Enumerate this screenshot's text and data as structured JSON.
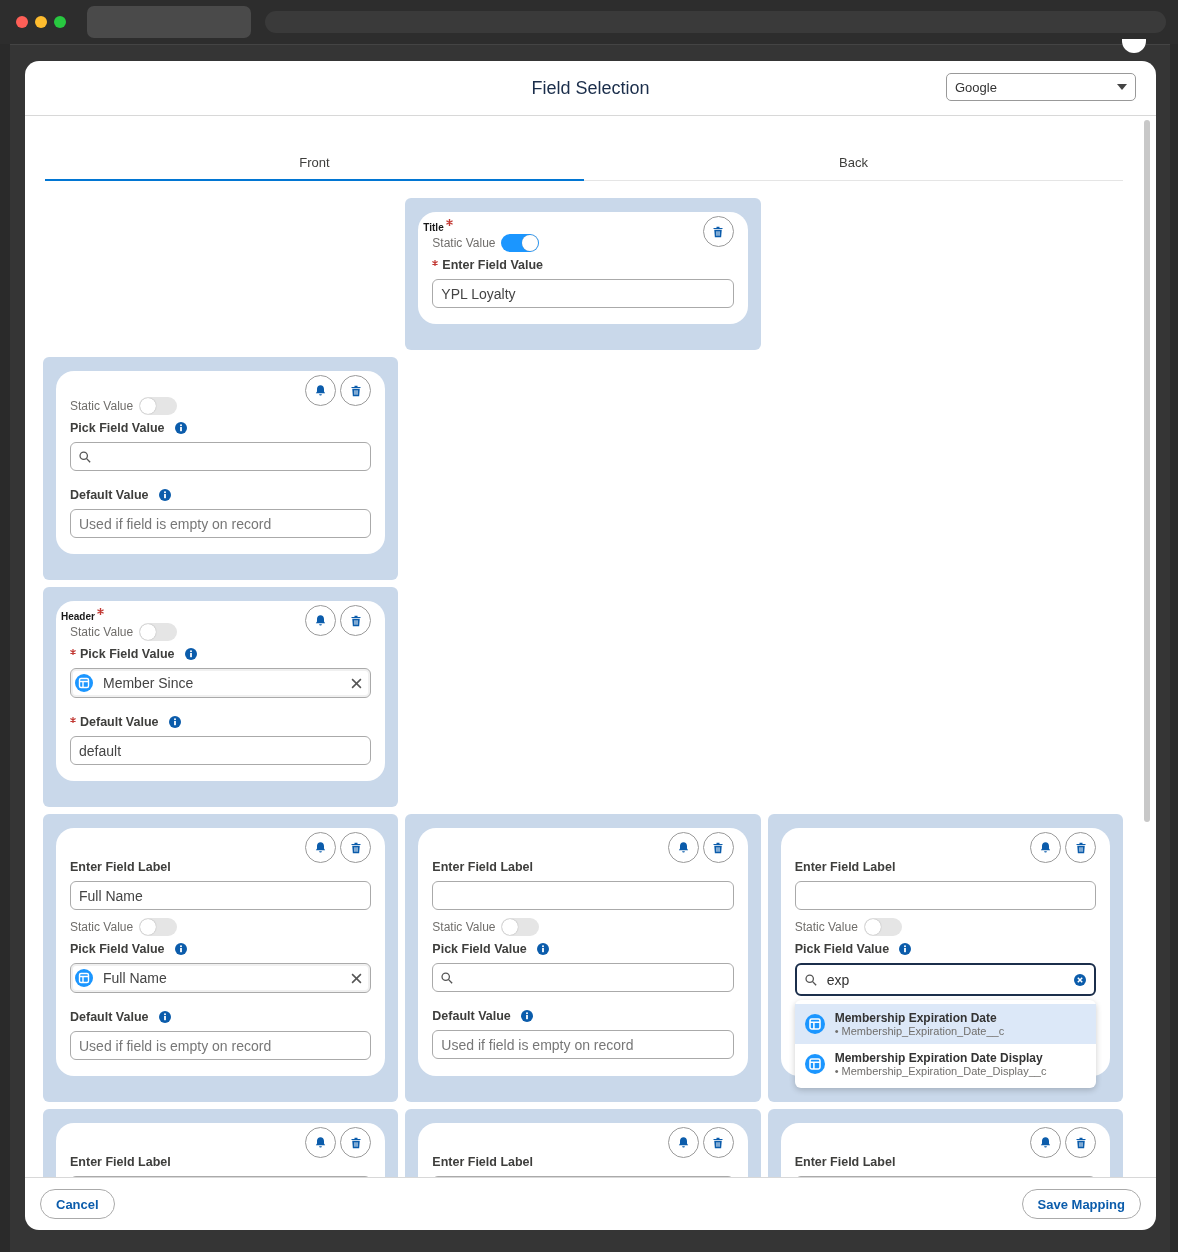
{
  "header": {
    "title": "Field Selection",
    "picker": {
      "value": "Google"
    }
  },
  "tabs": [
    {
      "label": "Front",
      "selected": true
    },
    {
      "label": "Back",
      "selected": false
    }
  ],
  "rows": [
    {
      "cells": [
        {
          "kind": "empty"
        },
        {
          "kind": "card",
          "section": "Title",
          "required": true,
          "bell": false,
          "parts": [
            {
              "kind": "toggle",
              "label": "Static Value",
              "on": true
            },
            {
              "kind": "label",
              "text": "Enter Field Value",
              "required": true,
              "info": false
            },
            {
              "kind": "text",
              "value": "YPL Loyalty"
            }
          ]
        },
        {
          "kind": "empty"
        }
      ]
    },
    {
      "cells": [
        {
          "kind": "card",
          "bell": true,
          "parts": [
            {
              "kind": "toggle",
              "label": "Static Value",
              "on": false
            },
            {
              "kind": "label",
              "text": "Pick Field Value",
              "required": false,
              "info": true
            },
            {
              "kind": "search",
              "focused": false
            },
            {
              "kind": "label",
              "text": "Default Value",
              "required": false,
              "info": true
            },
            {
              "kind": "text",
              "placeholder": "Used if field is empty on record"
            }
          ]
        },
        {
          "kind": "empty"
        },
        {
          "kind": "empty"
        }
      ]
    },
    {
      "cells": [
        {
          "kind": "card",
          "section": "Header",
          "required": true,
          "bell": true,
          "parts": [
            {
              "kind": "toggle",
              "label": "Static Value",
              "on": false
            },
            {
              "kind": "label",
              "text": "Pick Field Value",
              "required": true,
              "info": true
            },
            {
              "kind": "pill",
              "value": "Member Since"
            },
            {
              "kind": "label",
              "text": "Default Value",
              "required": true,
              "info": true
            },
            {
              "kind": "text",
              "value": "default"
            }
          ]
        },
        {
          "kind": "empty"
        },
        {
          "kind": "empty"
        }
      ]
    },
    {
      "cells": [
        {
          "kind": "card",
          "bell": true,
          "parts": [
            {
              "kind": "label",
              "text": "Enter Field Label",
              "required": false,
              "info": false
            },
            {
              "kind": "text",
              "value": "Full Name"
            },
            {
              "kind": "toggle",
              "label": "Static Value",
              "on": false
            },
            {
              "kind": "label",
              "text": "Pick Field Value",
              "required": false,
              "info": true
            },
            {
              "kind": "pill",
              "value": "Full Name"
            },
            {
              "kind": "label",
              "text": "Default Value",
              "required": false,
              "info": true
            },
            {
              "kind": "text",
              "placeholder": "Used if field is empty on record"
            }
          ]
        },
        {
          "kind": "card",
          "bell": true,
          "parts": [
            {
              "kind": "label",
              "text": "Enter Field Label",
              "required": false,
              "info": false
            },
            {
              "kind": "text"
            },
            {
              "kind": "toggle",
              "label": "Static Value",
              "on": false
            },
            {
              "kind": "label",
              "text": "Pick Field Value",
              "required": false,
              "info": true
            },
            {
              "kind": "search",
              "focused": false
            },
            {
              "kind": "label",
              "text": "Default Value",
              "required": false,
              "info": true
            },
            {
              "kind": "text",
              "placeholder": "Used if field is empty on record"
            }
          ]
        },
        {
          "kind": "card",
          "bell": true,
          "parts": [
            {
              "kind": "label",
              "text": "Enter Field Label",
              "required": false,
              "info": false
            },
            {
              "kind": "text"
            },
            {
              "kind": "toggle",
              "label": "Static Value",
              "on": false
            },
            {
              "kind": "label",
              "text": "Pick Field Value",
              "required": false,
              "info": true
            },
            {
              "kind": "search",
              "value": "exp",
              "focused": true,
              "options": [
                {
                  "label": "Membership Expiration Date",
                  "api_name": "• Membership_Expiration_Date__c",
                  "selected": true
                },
                {
                  "label": "Membership Expiration Date Display",
                  "api_name": "• Membership_Expiration_Date_Display__c",
                  "selected": false
                }
              ]
            }
          ]
        }
      ]
    },
    {
      "cells": [
        {
          "kind": "card",
          "bell": true,
          "parts": [
            {
              "kind": "label",
              "text": "Enter Field Label",
              "required": false,
              "info": false
            },
            {
              "kind": "text"
            }
          ]
        },
        {
          "kind": "card",
          "bell": true,
          "parts": [
            {
              "kind": "label",
              "text": "Enter Field Label",
              "required": false,
              "info": false
            },
            {
              "kind": "text"
            }
          ]
        },
        {
          "kind": "card",
          "bell": true,
          "parts": [
            {
              "kind": "label",
              "text": "Enter Field Label",
              "required": false,
              "info": false
            },
            {
              "kind": "text"
            }
          ]
        }
      ]
    }
  ],
  "footer": {
    "buttons": [
      "Cancel",
      "Save Mapping"
    ]
  }
}
